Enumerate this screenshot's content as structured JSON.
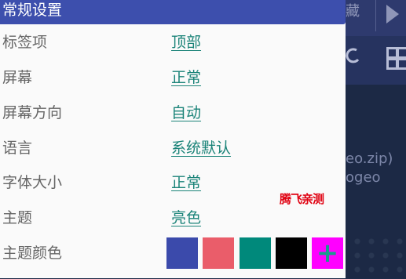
{
  "background_app": {
    "hide_label": "藏",
    "line1": "eo.zip)",
    "line2": "ogeo"
  },
  "panel": {
    "title": "常规设置",
    "rows": [
      {
        "label": "标签项",
        "value": "顶部"
      },
      {
        "label": "屏幕",
        "value": "正常"
      },
      {
        "label": "屏幕方向",
        "value": "自动"
      },
      {
        "label": "语言",
        "value": "系统默认"
      },
      {
        "label": "字体大小",
        "value": "正常"
      },
      {
        "label": "主题",
        "value": "亮色"
      },
      {
        "label": "主题颜色"
      }
    ],
    "theme_colors": [
      "#3b4aab",
      "#ea5d6a",
      "#00897b",
      "#000000",
      "#ff00ff"
    ],
    "add_symbol": "+"
  },
  "watermark": "腾飞亲测"
}
